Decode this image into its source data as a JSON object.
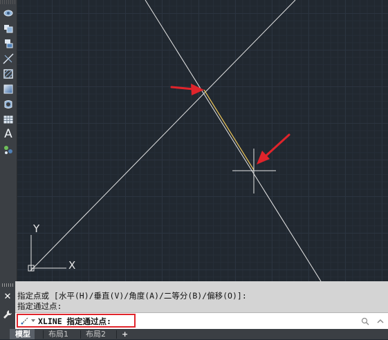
{
  "toolbar": {
    "items": [
      {
        "name": "group-icon"
      },
      {
        "name": "block-icon"
      },
      {
        "name": "insert-block-icon"
      },
      {
        "name": "xline-icon"
      },
      {
        "name": "hatch-icon"
      },
      {
        "name": "gradient-icon"
      },
      {
        "name": "region-icon"
      },
      {
        "name": "table-icon"
      },
      {
        "name": "multiline-text-icon",
        "glyph": "A"
      },
      {
        "name": "add-selected-icon"
      }
    ]
  },
  "viewport": {
    "background": "#212830",
    "line_color": "#e8e8e8",
    "highlight_color": "#e8c35a",
    "arrow_color": "#e0242b",
    "ucs": {
      "y_label": "Y",
      "x_label": "X"
    }
  },
  "command": {
    "history": [
      "指定点或 [水平(H)/垂直(V)/角度(A)/二等分(B)/偏移(O)]:",
      "指定通过点:"
    ],
    "prompt": "XLINE 指定通过点:",
    "input_value": "",
    "close_glyph": "✕",
    "highlight_color": "#e0242b"
  },
  "tabs": {
    "items": [
      "模型",
      "布局1",
      "布局2"
    ],
    "add_label": "+",
    "active_index": 0
  }
}
